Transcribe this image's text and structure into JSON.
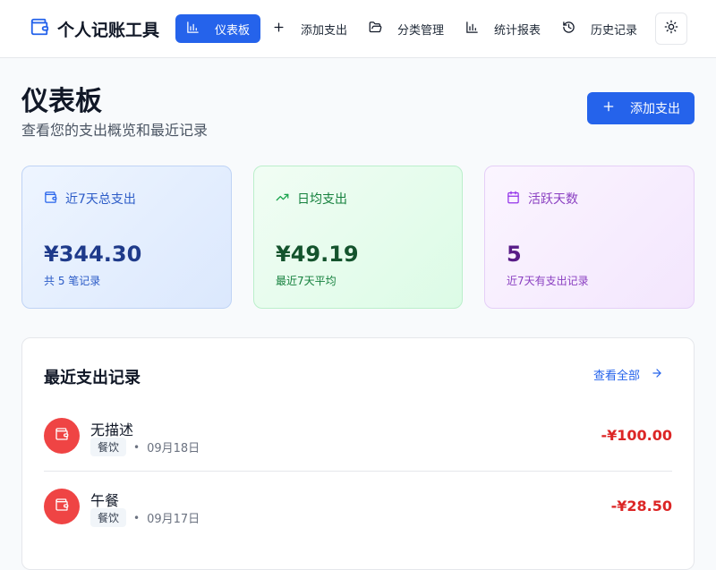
{
  "app": {
    "title": "个人记账工具"
  },
  "nav": {
    "items": [
      {
        "label": "仪表板",
        "icon": "bar-chart-icon",
        "active": true
      },
      {
        "label": "添加支出",
        "icon": "plus-icon"
      },
      {
        "label": "分类管理",
        "icon": "folder-open-icon"
      },
      {
        "label": "统计报表",
        "icon": "bar-chart-icon"
      },
      {
        "label": "历史记录",
        "icon": "history-icon"
      }
    ],
    "theme_icon": "sun-icon"
  },
  "page": {
    "title": "仪表板",
    "subtitle": "查看您的支出概览和最近记录",
    "add_button_label": "添加支出"
  },
  "stats": [
    {
      "label": "近7天总支出",
      "value": "¥344.30",
      "note": "共 5 笔记录",
      "icon": "wallet-icon",
      "color": "#2563eb"
    },
    {
      "label": "日均支出",
      "value": "¥49.19",
      "note": "最近7天平均",
      "icon": "trending-up-icon",
      "color": "#16a34a"
    },
    {
      "label": "活跃天数",
      "value": "5",
      "note": "近7天有支出记录",
      "icon": "calendar-icon",
      "color": "#9333ea"
    }
  ],
  "recent": {
    "title": "最近支出记录",
    "view_all_label": "查看全部",
    "items": [
      {
        "title": "无描述",
        "category": "餐饮",
        "date": "09月18日",
        "amount": "-¥100.00"
      },
      {
        "title": "午餐",
        "category": "餐饮",
        "date": "09月17日",
        "amount": "-¥28.50"
      }
    ]
  },
  "colors": {
    "accent": "#2563eb",
    "expense": "#dc2626",
    "category_dot": "#ef4444"
  }
}
